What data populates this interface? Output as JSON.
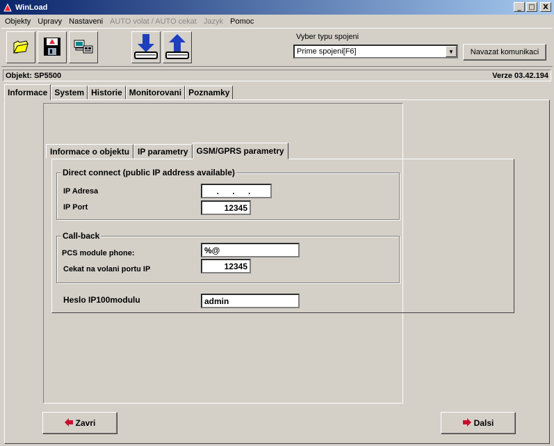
{
  "window": {
    "title": "WinLoad",
    "minimize": "_",
    "maximize": "□",
    "close": "X"
  },
  "menu": [
    {
      "label": "Objekty",
      "enabled": true
    },
    {
      "label": "Upravy",
      "enabled": true
    },
    {
      "label": "Nastaveni",
      "enabled": true
    },
    {
      "label": "AUTO volat / AUTO cekat",
      "enabled": false
    },
    {
      "label": "Jazyk",
      "enabled": false
    },
    {
      "label": "Pomoc",
      "enabled": true
    }
  ],
  "toolbar": {
    "icons": [
      "folder-icon",
      "save-disk-icon",
      "computer-lock-icon",
      "download-icon",
      "upload-icon"
    ],
    "connection_label": "Vyber typu spojeni",
    "connection_value": "Prime spojeni[F6]",
    "connect_button": "Navazat komunikaci"
  },
  "info": {
    "object": "Objekt: SP5500",
    "version": "Verze 03.42.194"
  },
  "main_tabs": [
    {
      "label": "Informace",
      "active": true
    },
    {
      "label": "System",
      "active": false
    },
    {
      "label": "Historie",
      "active": false
    },
    {
      "label": "Monitorovani",
      "active": false
    },
    {
      "label": "Poznamky",
      "active": false
    }
  ],
  "sub_tabs": [
    {
      "label": "Informace o objektu",
      "active": false
    },
    {
      "label": "IP parametry",
      "active": false
    },
    {
      "label": "GSM/GPRS parametry",
      "active": true
    }
  ],
  "direct": {
    "title": "Direct connect (public IP address available)",
    "ip_label": "IP Adresa",
    "ip_value": ". . .",
    "port_label": "IP Port",
    "port_value": "12345"
  },
  "callback": {
    "title": "Call-back",
    "phone_label": "PCS module phone:",
    "phone_value": "%@",
    "wait_label": "Cekat na volani portu IP",
    "wait_value": "12345"
  },
  "password": {
    "label": "Heslo IP100modulu",
    "value": "admin"
  },
  "buttons": {
    "close": "Zavri",
    "next": "Dalsi"
  },
  "colors": {
    "titlebar_start": "#0a246a",
    "titlebar_end": "#a6caf0",
    "face": "#d4d0c8",
    "arrow_red": "#c8102e",
    "arrow_blue": "#1f3fbf"
  }
}
